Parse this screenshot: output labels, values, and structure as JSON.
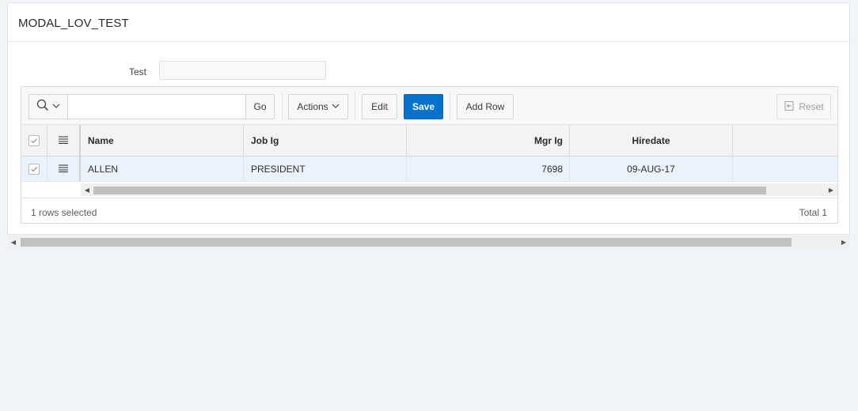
{
  "region": {
    "title": "MODAL_LOV_TEST"
  },
  "form": {
    "test_label": "Test",
    "test_value": ""
  },
  "toolbar": {
    "search_value": "",
    "go_label": "Go",
    "actions_label": "Actions",
    "edit_label": "Edit",
    "save_label": "Save",
    "add_row_label": "Add Row",
    "reset_label": "Reset"
  },
  "grid": {
    "columns": [
      "Name",
      "Job Ig",
      "Mgr Ig",
      "Hiredate"
    ],
    "rows": [
      {
        "name": "ALLEN",
        "job": "PRESIDENT",
        "mgr": "7698",
        "hiredate": "09-AUG-17",
        "selected": true
      }
    ]
  },
  "footer": {
    "selection_text": "1 rows selected",
    "total_text": "Total 1"
  },
  "colors": {
    "accent": "#0572ce",
    "row_selected": "#eaf3fd",
    "page_bg": "#f1f5f9"
  }
}
